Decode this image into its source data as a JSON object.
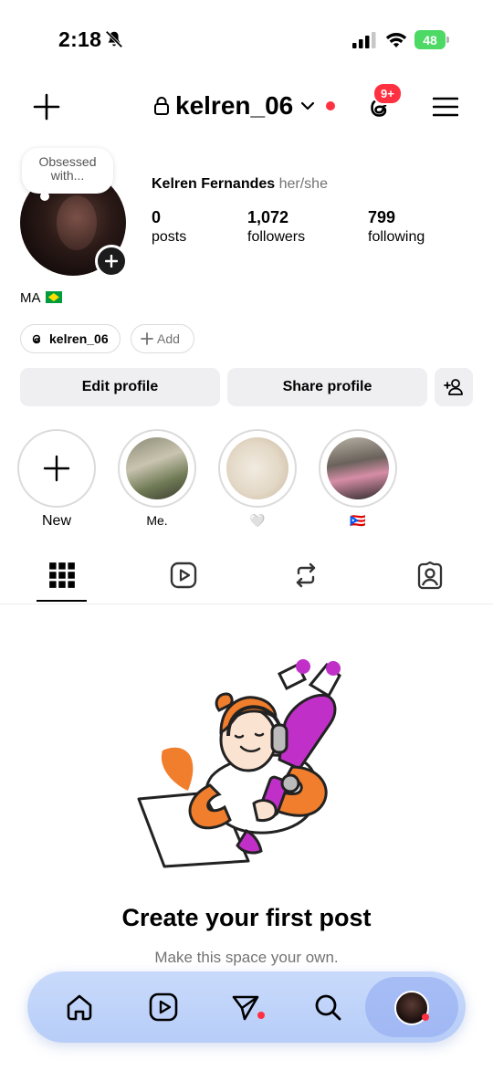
{
  "status": {
    "time": "2:18",
    "battery": "48"
  },
  "header": {
    "username": "kelren_06",
    "notif_badge": "9+"
  },
  "profile": {
    "note": "Obsessed with...",
    "full_name": "Kelren Fernandes",
    "pronouns": "her/she",
    "stats": [
      {
        "value": "0",
        "label": "posts"
      },
      {
        "value": "1,072",
        "label": "followers"
      },
      {
        "value": "799",
        "label": "following"
      }
    ],
    "bio": "MA",
    "threads_handle": "kelren_06",
    "add_link_label": "Add"
  },
  "buttons": {
    "edit": "Edit profile",
    "share": "Share profile"
  },
  "highlights": [
    {
      "label": "New"
    },
    {
      "label": "Me."
    },
    {
      "label": "🤍"
    },
    {
      "label": "🇵🇷"
    }
  ],
  "empty_state": {
    "title": "Create your first post",
    "subtitle": "Make this space your own."
  },
  "colors": {
    "accent_red": "#ff3040",
    "button_bg": "#efeff1",
    "nav_bg": "#c9dafb"
  }
}
